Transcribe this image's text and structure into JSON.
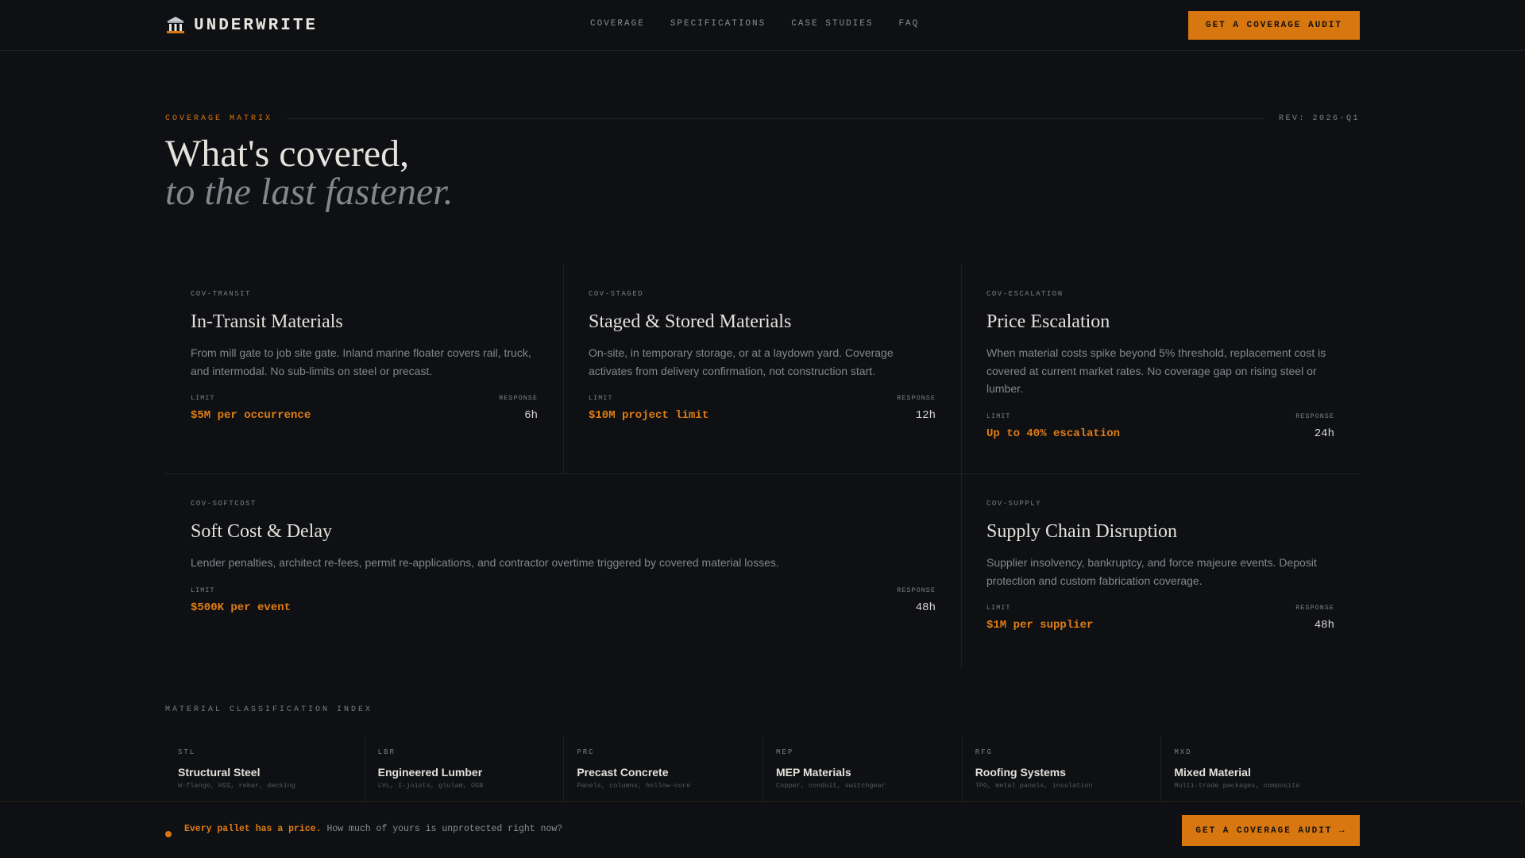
{
  "nav": {
    "brand": "UNDERWRITE",
    "brand_icon": "building-columns-icon",
    "links": [
      "COVERAGE",
      "SPECIFICATIONS",
      "CASE STUDIES",
      "FAQ"
    ],
    "cta": "GET A COVERAGE AUDIT"
  },
  "header": {
    "eyebrow": "COVERAGE MATRIX",
    "revision": "REV: 2026-Q1",
    "title_line1": "What's covered,",
    "title_line2": "to the last fastener."
  },
  "labels": {
    "limit": "LIMIT",
    "response": "RESPONSE"
  },
  "coverages": [
    {
      "id": "COV-TRANSIT",
      "title": "In-Transit Materials",
      "desc": "From mill gate to job site gate. Inland marine floater covers rail, truck, and intermodal. No sub-limits on steel or precast.",
      "limit": "$5M per occurrence",
      "response": "6h"
    },
    {
      "id": "COV-STAGED",
      "title": "Staged & Stored Materials",
      "desc": "On-site, in temporary storage, or at a laydown yard. Coverage activates from delivery confirmation, not construction start.",
      "limit": "$10M project limit",
      "response": "12h"
    },
    {
      "id": "COV-ESCALATION",
      "title": "Price Escalation",
      "desc": "When material costs spike beyond 5% threshold, replacement cost is covered at current market rates. No coverage gap on rising steel or lumber.",
      "limit": "Up to 40% escalation",
      "response": "24h"
    },
    {
      "id": "COV-SOFTCOST",
      "title": "Soft Cost & Delay",
      "desc": "Lender penalties, architect re-fees, permit re-applications, and contractor overtime triggered by covered material losses.",
      "limit": "$500K per event",
      "response": "48h"
    },
    {
      "id": "COV-SUPPLY",
      "title": "Supply Chain Disruption",
      "desc": "Supplier insolvency, bankruptcy, and force majeure events. Deposit protection and custom fabrication coverage.",
      "limit": "$1M per supplier",
      "response": "48h"
    }
  ],
  "index": {
    "title": "MATERIAL CLASSIFICATION INDEX",
    "items": [
      {
        "code": "STL",
        "name": "Structural Steel",
        "sub": "W-flange, HSS, rebar, decking"
      },
      {
        "code": "LBR",
        "name": "Engineered Lumber",
        "sub": "LVL, I-joists, glulam, OSB"
      },
      {
        "code": "PRC",
        "name": "Precast Concrete",
        "sub": "Panels, columns, hollow-core"
      },
      {
        "code": "MEP",
        "name": "MEP Materials",
        "sub": "Copper, conduit, switchgear"
      },
      {
        "code": "RFG",
        "name": "Roofing Systems",
        "sub": "TPO, metal panels, insulation"
      },
      {
        "code": "MXD",
        "name": "Mixed Material",
        "sub": "Multi-trade packages, composite"
      }
    ]
  },
  "sticky": {
    "strong": "Every pallet has a price.",
    "text": "How much of yours is unprotected right now?",
    "cta": "GET A COVERAGE AUDIT →"
  }
}
